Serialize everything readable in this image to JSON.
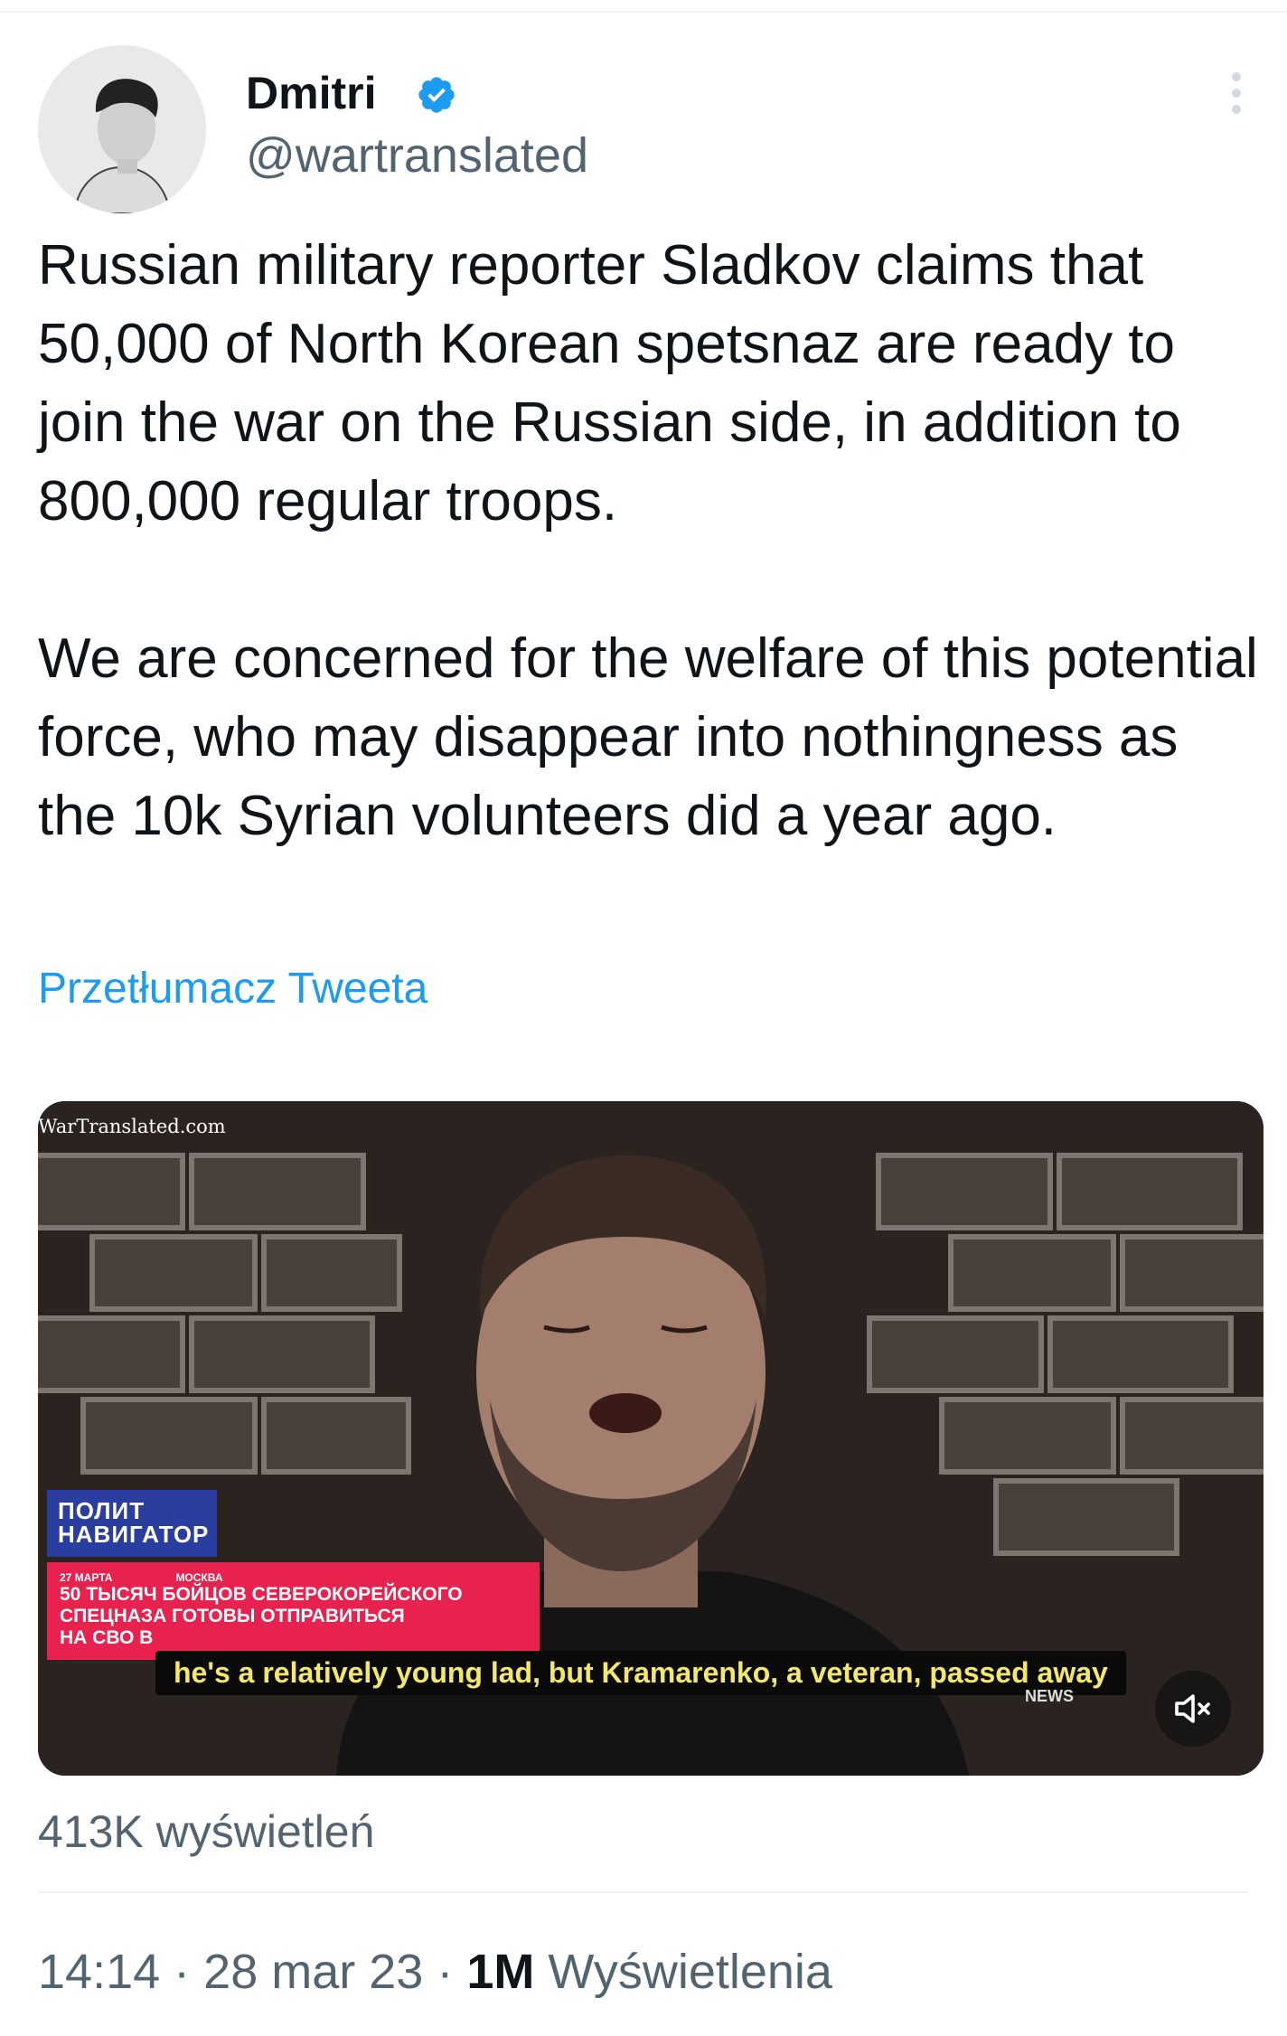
{
  "author": {
    "display_name": "Dmitri",
    "handle": "@wartranslated",
    "verified_icon": "verified-badge-icon"
  },
  "tweet": {
    "paragraphs": [
      "Russian military reporter Sladkov claims that 50,000 of North Korean spetsnaz are ready to join the war on the Russian side, in addition to 800,000 regular troops.",
      "We are concerned for the welfare of this potential force, who may disappear into nothingness as the 10k Syrian volunteers did a year ago."
    ],
    "translate_label": "Przetłumacz Tweeta"
  },
  "media": {
    "watermark": "WarTranslated.com",
    "channel_logo": "ПОЛИТ НАВИГАТОР",
    "news_date": "27 МАРТА",
    "news_city": "МОСКВА",
    "news_line_1": "50 ТЫСЯЧ БОЙЦОВ СЕВЕРОКОРЕЙСКОГО",
    "news_line_2": "СПЕЦНАЗА ГОТОВЫ ОТПРАВИТЬСЯ",
    "news_line_3": "НА СВО В",
    "subtitle": "he's a relatively young lad, but Kramarenko, a veteran, passed away",
    "news_tag": "NEWS",
    "mute_icon": "muted-speaker-icon"
  },
  "stats": {
    "views_count": "413K wyświetleń",
    "time": "14:14",
    "date": "28 mar 23",
    "views_short": "1M",
    "views_label": "Wyświetlenia",
    "separator": "·"
  },
  "colors": {
    "link": "#1d9bf0",
    "secondary_text": "#536471",
    "verified": "#1d9bf0"
  }
}
